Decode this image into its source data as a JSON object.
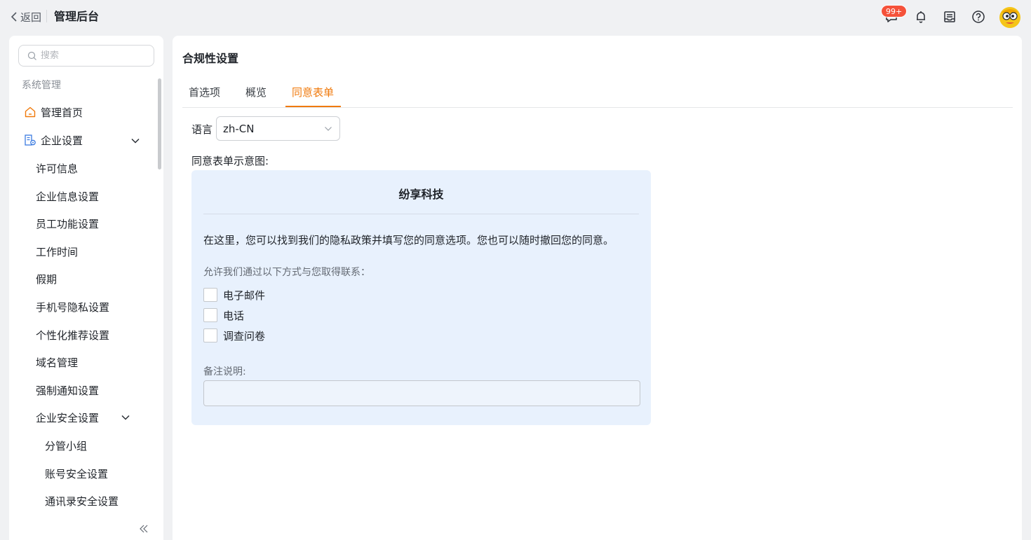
{
  "header": {
    "back_label": "返回",
    "app_title": "管理后台",
    "message_badge": "99+"
  },
  "sidebar": {
    "search_placeholder": "搜索",
    "section_label": "系统管理",
    "items": [
      {
        "label": "管理首页"
      },
      {
        "label": "企业设置"
      },
      {
        "label": "许可信息"
      },
      {
        "label": "企业信息设置"
      },
      {
        "label": "员工功能设置"
      },
      {
        "label": "工作时间"
      },
      {
        "label": "假期"
      },
      {
        "label": "手机号隐私设置"
      },
      {
        "label": "个性化推荐设置"
      },
      {
        "label": "域名管理"
      },
      {
        "label": "强制通知设置"
      },
      {
        "label": "企业安全设置"
      },
      {
        "label": "分管小组"
      },
      {
        "label": "账号安全设置"
      },
      {
        "label": "通讯录安全设置"
      }
    ]
  },
  "main": {
    "title": "合规性设置",
    "tabs": [
      {
        "label": "首选项"
      },
      {
        "label": "概览"
      },
      {
        "label": "同意表单"
      }
    ],
    "active_tab": "同意表单",
    "language_label": "语言",
    "language_value": "zh-CN",
    "preview_label": "同意表单示意图:",
    "form": {
      "company": "纷享科技",
      "description": "在这里，您可以找到我们的隐私政策并填写您的同意选项。您也可以随时撤回您的同意。",
      "contact_prompt": "允许我们通过以下方式与您取得联系：",
      "options": [
        {
          "label": "电子邮件",
          "checked": false
        },
        {
          "label": "电话",
          "checked": false
        },
        {
          "label": "调查问卷",
          "checked": false
        }
      ],
      "note_label": "备注说明:",
      "note_value": ""
    }
  },
  "colors": {
    "accent": "#f07a0c",
    "badge": "#f5523a",
    "card_bg": "#e8f1fd"
  }
}
